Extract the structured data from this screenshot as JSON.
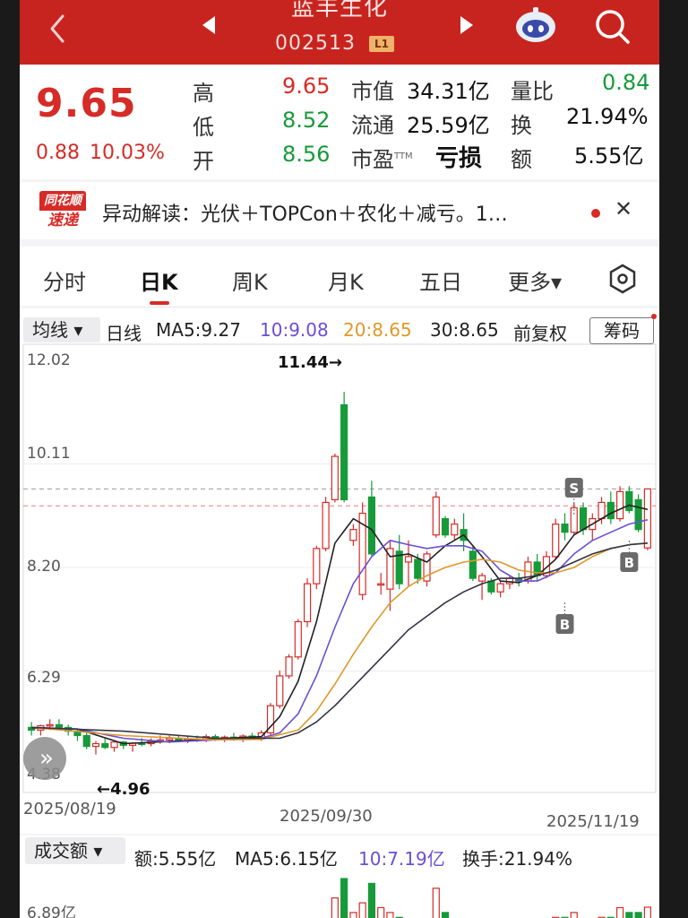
{
  "header": {
    "stock_name": "蓝丰生化",
    "stock_code": "002513",
    "level_badge": "L1",
    "icons": [
      "back-icon",
      "prev-arrow-icon",
      "next-arrow-icon",
      "robot-icon",
      "search-icon"
    ]
  },
  "quote": {
    "price": "9.65",
    "change": "0.88",
    "change_pct": "10.03%",
    "high_label": "高",
    "high": "9.65",
    "low_label": "低",
    "low": "8.52",
    "open_label": "开",
    "open": "8.56",
    "mktcap_label": "市值",
    "mktcap": "34.31亿",
    "float_label": "流通",
    "float": "25.59亿",
    "pe_label": "市盈",
    "pe_suffix": "TTM",
    "pe": "亏损",
    "volratio_label": "量比",
    "volratio": "0.84",
    "turnover_label": "换",
    "turnover": "21.94%",
    "amount_label": "额",
    "amount": "5.55亿"
  },
  "news": {
    "logo_top": "同花顺",
    "logo_bottom": "速递",
    "text": "异动解读：光伏＋TOPCon＋农化＋减亏。1…"
  },
  "tabs": [
    "分时",
    "日K",
    "周K",
    "月K",
    "五日",
    "更多▾"
  ],
  "selected_tab": "日K",
  "chart": {
    "ma_selector": "均线 ▾",
    "period": "日线",
    "ma5": "MA5:9.27",
    "ma10": "10:9.08",
    "ma20": "20:8.65",
    "ma30": "30:8.65",
    "adjust": "前复权",
    "chips_button": "筹码",
    "y_labels": [
      "12.02",
      "10.11",
      "8.20",
      "6.29",
      "4.38"
    ],
    "dates": [
      "2025/08/19",
      "2025/09/30",
      "2025/11/19"
    ],
    "max_label": "11.44→",
    "min_label": "←4.96",
    "markers": [
      "S",
      "B",
      "B"
    ]
  },
  "volume": {
    "selector": "成交额 ▾",
    "amount": "额:5.55亿",
    "ma5": "MA5:6.15亿",
    "ma10": "10:7.19亿",
    "turnover": "换手:21.94%",
    "y_label": "6.89亿"
  },
  "colors": {
    "up": "#d62b26",
    "down": "#169a3a",
    "ma5": "#222222",
    "ma10": "#6a4fd6",
    "ma20": "#e0982a",
    "ma30": "#333344",
    "header": "#c8241f"
  },
  "chart_data": {
    "type": "candlestick",
    "ylim": [
      4.38,
      12.02
    ],
    "ohlc": [
      {
        "o": 5.25,
        "h": 5.35,
        "l": 5.1,
        "c": 5.2
      },
      {
        "o": 5.2,
        "h": 5.3,
        "l": 5.1,
        "c": 5.28
      },
      {
        "o": 5.28,
        "h": 5.4,
        "l": 5.2,
        "c": 5.3
      },
      {
        "o": 5.3,
        "h": 5.4,
        "l": 5.22,
        "c": 5.25
      },
      {
        "o": 5.25,
        "h": 5.3,
        "l": 5.1,
        "c": 5.18
      },
      {
        "o": 5.18,
        "h": 5.22,
        "l": 5.0,
        "c": 5.1
      },
      {
        "o": 5.1,
        "h": 5.2,
        "l": 4.85,
        "c": 4.9
      },
      {
        "o": 4.9,
        "h": 5.0,
        "l": 4.75,
        "c": 4.95
      },
      {
        "o": 4.95,
        "h": 5.05,
        "l": 4.85,
        "c": 4.88
      },
      {
        "o": 4.88,
        "h": 5.0,
        "l": 4.8,
        "c": 4.98
      },
      {
        "o": 4.98,
        "h": 5.0,
        "l": 4.85,
        "c": 4.92
      },
      {
        "o": 4.92,
        "h": 4.98,
        "l": 4.8,
        "c": 4.96
      },
      {
        "o": 4.96,
        "h": 5.05,
        "l": 4.9,
        "c": 4.95
      },
      {
        "o": 4.95,
        "h": 5.05,
        "l": 4.9,
        "c": 5.0
      },
      {
        "o": 5.0,
        "h": 5.1,
        "l": 4.95,
        "c": 5.02
      },
      {
        "o": 5.02,
        "h": 5.1,
        "l": 4.96,
        "c": 5.05
      },
      {
        "o": 5.05,
        "h": 5.1,
        "l": 4.98,
        "c": 5.0
      },
      {
        "o": 5.0,
        "h": 5.08,
        "l": 4.96,
        "c": 5.04
      },
      {
        "o": 5.04,
        "h": 5.1,
        "l": 4.98,
        "c": 5.02
      },
      {
        "o": 5.02,
        "h": 5.12,
        "l": 4.98,
        "c": 5.08
      },
      {
        "o": 5.08,
        "h": 5.12,
        "l": 5.0,
        "c": 5.03
      },
      {
        "o": 5.03,
        "h": 5.1,
        "l": 4.98,
        "c": 5.07
      },
      {
        "o": 5.07,
        "h": 5.15,
        "l": 5.0,
        "c": 5.05
      },
      {
        "o": 5.05,
        "h": 5.12,
        "l": 4.98,
        "c": 5.09
      },
      {
        "o": 5.09,
        "h": 5.15,
        "l": 5.02,
        "c": 5.04
      },
      {
        "o": 5.04,
        "h": 5.2,
        "l": 5.0,
        "c": 5.15
      },
      {
        "o": 5.15,
        "h": 5.7,
        "l": 5.1,
        "c": 5.65
      },
      {
        "o": 5.65,
        "h": 6.3,
        "l": 5.6,
        "c": 6.2
      },
      {
        "o": 6.2,
        "h": 6.6,
        "l": 6.15,
        "c": 6.55
      },
      {
        "o": 6.55,
        "h": 7.25,
        "l": 6.5,
        "c": 7.2
      },
      {
        "o": 7.2,
        "h": 8.0,
        "l": 7.1,
        "c": 7.9
      },
      {
        "o": 7.9,
        "h": 8.6,
        "l": 7.8,
        "c": 8.55
      },
      {
        "o": 8.55,
        "h": 9.5,
        "l": 8.5,
        "c": 9.4
      },
      {
        "o": 9.45,
        "h": 10.3,
        "l": 9.4,
        "c": 10.25
      },
      {
        "o": 11.2,
        "h": 11.44,
        "l": 9.4,
        "c": 9.45
      },
      {
        "o": 8.7,
        "h": 9.0,
        "l": 8.6,
        "c": 8.9
      },
      {
        "o": 7.7,
        "h": 9.4,
        "l": 7.6,
        "c": 9.2
      },
      {
        "o": 9.5,
        "h": 9.8,
        "l": 8.4,
        "c": 8.45
      },
      {
        "o": 7.9,
        "h": 8.1,
        "l": 7.7,
        "c": 7.9
      },
      {
        "o": 7.8,
        "h": 8.7,
        "l": 7.4,
        "c": 8.55
      },
      {
        "o": 8.5,
        "h": 8.8,
        "l": 7.8,
        "c": 7.9
      },
      {
        "o": 8.3,
        "h": 8.7,
        "l": 7.85,
        "c": 8.4
      },
      {
        "o": 8.35,
        "h": 8.45,
        "l": 7.9,
        "c": 8.0
      },
      {
        "o": 7.95,
        "h": 8.5,
        "l": 7.85,
        "c": 8.45
      },
      {
        "o": 8.8,
        "h": 9.6,
        "l": 8.75,
        "c": 9.5
      },
      {
        "o": 9.1,
        "h": 9.15,
        "l": 8.75,
        "c": 8.8
      },
      {
        "o": 8.8,
        "h": 9.1,
        "l": 8.7,
        "c": 9.0
      },
      {
        "o": 8.9,
        "h": 9.2,
        "l": 8.5,
        "c": 8.7
      },
      {
        "o": 8.5,
        "h": 8.6,
        "l": 7.95,
        "c": 8.0
      },
      {
        "o": 7.95,
        "h": 8.1,
        "l": 7.6,
        "c": 8.05
      },
      {
        "o": 7.95,
        "h": 8.0,
        "l": 7.7,
        "c": 7.75
      },
      {
        "o": 7.75,
        "h": 7.95,
        "l": 7.65,
        "c": 7.9
      },
      {
        "o": 7.9,
        "h": 8.05,
        "l": 7.8,
        "c": 8.0
      },
      {
        "o": 8.0,
        "h": 8.1,
        "l": 7.85,
        "c": 7.95
      },
      {
        "o": 7.95,
        "h": 8.4,
        "l": 7.9,
        "c": 8.3
      },
      {
        "o": 8.3,
        "h": 8.45,
        "l": 7.95,
        "c": 8.05
      },
      {
        "o": 8.05,
        "h": 8.5,
        "l": 8.0,
        "c": 8.4
      },
      {
        "o": 8.4,
        "h": 9.1,
        "l": 8.35,
        "c": 9.0
      },
      {
        "o": 9.0,
        "h": 9.2,
        "l": 8.7,
        "c": 8.85
      },
      {
        "o": 8.85,
        "h": 9.4,
        "l": 8.8,
        "c": 9.3
      },
      {
        "o": 9.3,
        "h": 9.4,
        "l": 8.8,
        "c": 8.9
      },
      {
        "o": 8.9,
        "h": 9.2,
        "l": 8.7,
        "c": 9.1
      },
      {
        "o": 9.1,
        "h": 9.5,
        "l": 9.0,
        "c": 9.4
      },
      {
        "o": 9.4,
        "h": 9.6,
        "l": 9.0,
        "c": 9.1
      },
      {
        "o": 9.1,
        "h": 9.7,
        "l": 9.05,
        "c": 9.6
      },
      {
        "o": 9.6,
        "h": 9.7,
        "l": 9.2,
        "c": 9.25
      },
      {
        "o": 9.45,
        "h": 9.55,
        "l": 8.85,
        "c": 8.9
      },
      {
        "o": 8.56,
        "h": 9.65,
        "l": 8.52,
        "c": 9.65
      }
    ],
    "ma_series": [
      {
        "name": "MA5",
        "points": [
          [
            0,
            5.24
          ],
          [
            5,
            5.22
          ],
          [
            10,
            4.95
          ],
          [
            15,
            4.99
          ],
          [
            20,
            5.04
          ],
          [
            25,
            5.08
          ],
          [
            27,
            5.45
          ],
          [
            29,
            6.1
          ],
          [
            31,
            7.2
          ],
          [
            33,
            8.65
          ],
          [
            35,
            9.1
          ],
          [
            37,
            8.9
          ],
          [
            39,
            8.4
          ],
          [
            41,
            8.45
          ],
          [
            43,
            8.3
          ],
          [
            45,
            8.6
          ],
          [
            47,
            8.8
          ],
          [
            49,
            8.4
          ],
          [
            51,
            7.95
          ],
          [
            53,
            7.92
          ],
          [
            55,
            8.05
          ],
          [
            57,
            8.35
          ],
          [
            59,
            8.8
          ],
          [
            61,
            9.0
          ],
          [
            63,
            9.2
          ],
          [
            65,
            9.35
          ],
          [
            67,
            9.27
          ]
        ]
      },
      {
        "name": "MA10",
        "points": [
          [
            0,
            5.25
          ],
          [
            5,
            5.22
          ],
          [
            10,
            5.05
          ],
          [
            15,
            4.98
          ],
          [
            20,
            5.02
          ],
          [
            25,
            5.05
          ],
          [
            27,
            5.15
          ],
          [
            29,
            5.5
          ],
          [
            31,
            6.2
          ],
          [
            33,
            7.1
          ],
          [
            35,
            7.9
          ],
          [
            37,
            8.4
          ],
          [
            39,
            8.7
          ],
          [
            41,
            8.62
          ],
          [
            43,
            8.55
          ],
          [
            45,
            8.6
          ],
          [
            47,
            8.6
          ],
          [
            49,
            8.5
          ],
          [
            51,
            8.15
          ],
          [
            53,
            7.95
          ],
          [
            55,
            7.95
          ],
          [
            57,
            8.1
          ],
          [
            59,
            8.45
          ],
          [
            61,
            8.7
          ],
          [
            63,
            8.85
          ],
          [
            65,
            9.0
          ],
          [
            67,
            9.08
          ]
        ]
      },
      {
        "name": "20",
        "points": [
          [
            0,
            5.25
          ],
          [
            10,
            5.1
          ],
          [
            20,
            5.02
          ],
          [
            25,
            5.03
          ],
          [
            29,
            5.2
          ],
          [
            31,
            5.55
          ],
          [
            33,
            6.05
          ],
          [
            35,
            6.6
          ],
          [
            37,
            7.1
          ],
          [
            39,
            7.55
          ],
          [
            41,
            7.85
          ],
          [
            43,
            8.05
          ],
          [
            45,
            8.2
          ],
          [
            47,
            8.3
          ],
          [
            49,
            8.35
          ],
          [
            51,
            8.3
          ],
          [
            53,
            8.15
          ],
          [
            55,
            8.1
          ],
          [
            57,
            8.1
          ],
          [
            59,
            8.2
          ],
          [
            61,
            8.4
          ],
          [
            63,
            8.55
          ],
          [
            65,
            8.62
          ],
          [
            67,
            8.65
          ]
        ]
      },
      {
        "name": "30",
        "points": [
          [
            0,
            5.25
          ],
          [
            10,
            5.18
          ],
          [
            20,
            5.05
          ],
          [
            27,
            5.05
          ],
          [
            29,
            5.15
          ],
          [
            31,
            5.35
          ],
          [
            33,
            5.65
          ],
          [
            35,
            6.0
          ],
          [
            37,
            6.35
          ],
          [
            39,
            6.7
          ],
          [
            41,
            7.05
          ],
          [
            43,
            7.3
          ],
          [
            45,
            7.55
          ],
          [
            47,
            7.75
          ],
          [
            49,
            7.9
          ],
          [
            51,
            8.0
          ],
          [
            53,
            8.0
          ],
          [
            55,
            8.05
          ],
          [
            57,
            8.15
          ],
          [
            59,
            8.3
          ],
          [
            61,
            8.45
          ],
          [
            63,
            8.55
          ],
          [
            65,
            8.62
          ],
          [
            67,
            8.65
          ]
        ]
      }
    ],
    "volume_values": [
      0.6,
      0.5,
      0.5,
      0.4,
      0.5,
      0.5,
      0.6,
      0.5,
      0.5,
      0.4,
      0.4,
      0.4,
      0.4,
      0.4,
      0.4,
      0.4,
      0.4,
      0.4,
      0.4,
      0.4,
      0.4,
      0.4,
      0.4,
      0.4,
      0.4,
      0.6,
      1.0,
      1.5,
      2.0,
      2.4,
      2.8,
      3.0,
      3.4,
      6.5,
      8.5,
      5.0,
      6.0,
      8.0,
      5.5,
      5.0,
      4.5,
      4.0,
      4.0,
      3.5,
      7.5,
      5.0,
      4.0,
      3.5,
      3.0,
      3.0,
      2.5,
      2.5,
      2.5,
      2.5,
      3.0,
      3.0,
      3.5,
      4.5,
      4.5,
      5.0,
      4.0,
      4.0,
      4.5,
      4.5,
      5.5,
      5.0,
      5.0,
      5.55
    ]
  }
}
